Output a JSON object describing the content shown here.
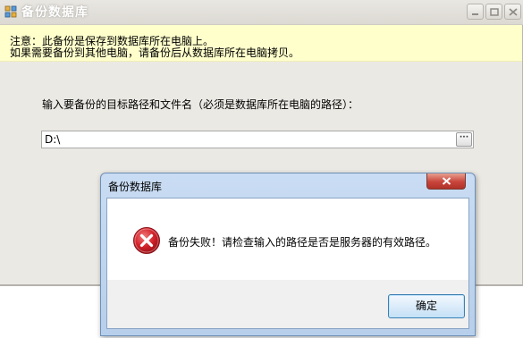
{
  "main_window": {
    "title": "备份数据库",
    "notice_line1": "注意：此备份是保存到数据库所在电脑上。",
    "notice_line2": "如果需要备份到其他电脑，请备份后从数据库所在电脑拷贝。",
    "path_prompt": "输入要备份的目标路径和文件名（必须是数据库所在电脑的路径）：",
    "path_value": "D:\\",
    "browse_label": "···"
  },
  "dialog": {
    "title": "备份数据库",
    "message": "备份失败！请检查输入的路径是否是服务器的有效路径。",
    "ok_label": "确定",
    "icon": "error-icon"
  },
  "colors": {
    "notice_bg": "#ffffcc",
    "dialog_frame": "#b7cfeb",
    "error_red": "#d2222a"
  }
}
